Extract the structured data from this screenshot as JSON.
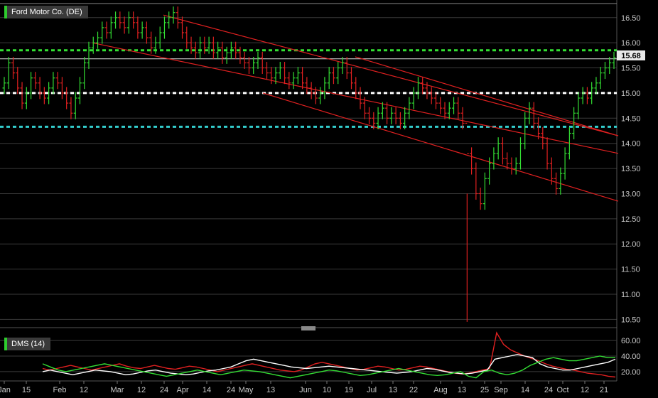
{
  "chart_data": [
    {
      "type": "ohlc",
      "title": "Ford Motor Co. (DE)",
      "ylim": [
        10.35,
        16.85
      ],
      "y_ticks": [
        "16.50",
        "16.00",
        "15.50",
        "15.00",
        "14.50",
        "14.00",
        "13.50",
        "13.00",
        "12.50",
        "12.00",
        "11.50",
        "11.00",
        "10.50"
      ],
      "x_ticks": [
        "Jan",
        "15",
        "Feb",
        "12",
        "Mar",
        "12",
        "24",
        "Apr",
        "14",
        "24",
        "May",
        "13",
        "Jun",
        "10",
        "19",
        "Jul",
        "13",
        "22",
        "Aug",
        "13",
        "25",
        "Sep",
        "14",
        "24",
        "Oct",
        "12",
        "21"
      ],
      "last_price": "15.68",
      "horizontal_levels": [
        {
          "value": 15.85,
          "color": "#33e033",
          "style": "dashed"
        },
        {
          "value": 15.0,
          "color": "#ffffff",
          "style": "dashed"
        },
        {
          "value": 14.33,
          "color": "#33cccc",
          "style": "dashed"
        }
      ],
      "trend_channels": [
        {
          "color": "#e02020",
          "from": [
            230,
            16.55
          ],
          "to": [
            870,
            14.15
          ]
        },
        {
          "color": "#e02020",
          "from": [
            130,
            16.0
          ],
          "to": [
            870,
            13.8
          ]
        },
        {
          "color": "#e02020",
          "from": [
            370,
            15.0
          ],
          "to": [
            870,
            12.85
          ]
        },
        {
          "color": "#e02020",
          "from": [
            500,
            15.72
          ],
          "to": [
            870,
            14.15
          ]
        }
      ],
      "series": [
        {
          "name": "price",
          "color_up": "#33dd33",
          "color_down": "#e02020",
          "close": [
            15.2,
            15.6,
            15.4,
            15.1,
            14.8,
            15.0,
            15.3,
            15.2,
            15.0,
            14.9,
            15.1,
            15.3,
            15.2,
            15.0,
            14.8,
            14.6,
            14.9,
            15.2,
            15.6,
            15.9,
            16.0,
            16.1,
            16.3,
            16.2,
            16.4,
            16.5,
            16.4,
            16.3,
            16.5,
            16.4,
            16.2,
            16.3,
            16.1,
            15.9,
            16.0,
            16.2,
            16.4,
            16.5,
            16.6,
            16.4,
            16.2,
            16.0,
            15.9,
            15.8,
            16.0,
            15.9,
            16.0,
            15.8,
            15.9,
            15.7,
            15.8,
            15.9,
            15.8,
            15.7,
            15.6,
            15.5,
            15.6,
            15.7,
            15.5,
            15.4,
            15.3,
            15.4,
            15.5,
            15.3,
            15.2,
            15.3,
            15.4,
            15.2,
            15.1,
            15.0,
            14.9,
            15.0,
            15.2,
            15.4,
            15.3,
            15.5,
            15.6,
            15.4,
            15.2,
            15.0,
            14.8,
            14.6,
            14.5,
            14.4,
            14.6,
            14.7,
            14.5,
            14.6,
            14.5,
            14.4,
            14.6,
            14.8,
            15.0,
            15.2,
            15.1,
            15.0,
            14.9,
            14.8,
            14.7,
            14.6,
            14.7,
            14.8,
            14.6,
            14.4,
            13.8,
            13.5,
            13.0,
            12.8,
            13.3,
            13.6,
            13.8,
            14.0,
            13.7,
            13.6,
            13.5,
            13.6,
            14.0,
            14.5,
            14.7,
            14.4,
            14.2,
            14.0,
            13.6,
            13.3,
            13.1,
            13.4,
            13.8,
            14.2,
            14.6,
            14.9,
            15.0,
            14.9,
            15.1,
            15.2,
            15.4,
            15.5,
            15.6,
            15.7
          ]
        },
        {
          "name": "DMS (14)",
          "values": []
        }
      ]
    },
    {
      "type": "line",
      "title": "DMS (14)",
      "ylim": [
        8,
        72
      ],
      "y_ticks": [
        "60.00",
        "40.00",
        "20.00"
      ],
      "series": [
        {
          "name": "",
          "color": "#e02020",
          "values": [
            24,
            22,
            24,
            26,
            28,
            26,
            24,
            22,
            24,
            26,
            28,
            30,
            27,
            25,
            24,
            26,
            28,
            26,
            24,
            23,
            25,
            27,
            26,
            24,
            22,
            20,
            22,
            24,
            26,
            28,
            30,
            28,
            26,
            24,
            22,
            21,
            20,
            22,
            26,
            30,
            32,
            30,
            28,
            26,
            24,
            22,
            23,
            25,
            27,
            26,
            24,
            22,
            23,
            25,
            27,
            26,
            24,
            22,
            20,
            18,
            17,
            18,
            20,
            22,
            24,
            70,
            55,
            48,
            44,
            40,
            37,
            34,
            30,
            27,
            25,
            23,
            22,
            20,
            18,
            17,
            16,
            14,
            13
          ]
        },
        {
          "name": "",
          "color": "#ffffff",
          "values": [
            20,
            22,
            20,
            18,
            16,
            18,
            20,
            22,
            21,
            20,
            18,
            16,
            17,
            19,
            21,
            22,
            20,
            18,
            17,
            16,
            17,
            19,
            21,
            22,
            24,
            26,
            30,
            34,
            36,
            34,
            32,
            30,
            28,
            26,
            25,
            24,
            25,
            26,
            27,
            26,
            25,
            24,
            23,
            22,
            21,
            20,
            19,
            18,
            19,
            20,
            22,
            24,
            23,
            21,
            19,
            18,
            17,
            18,
            20,
            22,
            36,
            38,
            40,
            42,
            40,
            38,
            30,
            26,
            24,
            22,
            22,
            24,
            26,
            28,
            30,
            32,
            36
          ]
        },
        {
          "name": "",
          "color": "#33dd33",
          "values": [
            30,
            26,
            22,
            20,
            22,
            24,
            26,
            28,
            30,
            28,
            26,
            24,
            22,
            20,
            18,
            16,
            14,
            16,
            18,
            20,
            22,
            20,
            18,
            16,
            18,
            20,
            22,
            21,
            20,
            18,
            16,
            14,
            12,
            14,
            16,
            18,
            20,
            22,
            21,
            19,
            17,
            15,
            16,
            18,
            20,
            22,
            24,
            22,
            20,
            18,
            16,
            15,
            16,
            18,
            20,
            14,
            12,
            20,
            22,
            18,
            16,
            18,
            22,
            28,
            32,
            36,
            38,
            36,
            34,
            34,
            36,
            38,
            40,
            38,
            38
          ]
        }
      ]
    }
  ]
}
